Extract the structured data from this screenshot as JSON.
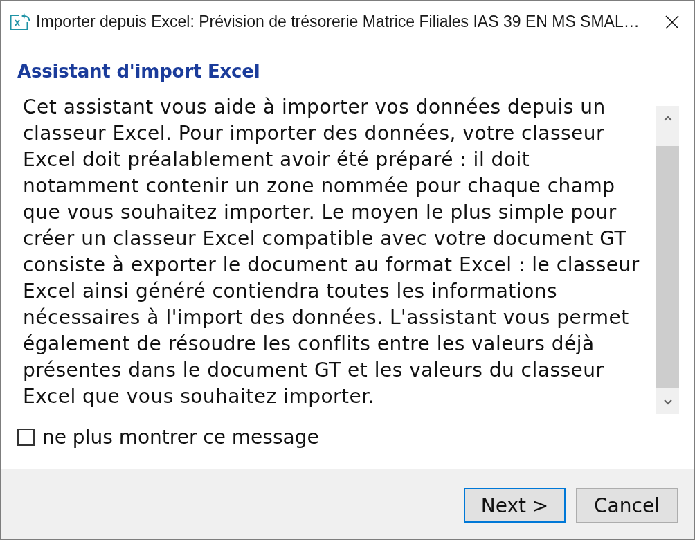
{
  "window": {
    "title": "Importer depuis Excel: Prévision de trésorerie Matrice Filiales IAS 39 EN MS SMAL…"
  },
  "heading": "Assistant d'import Excel",
  "message": "Cet assistant vous aide à importer vos données depuis un classeur Excel. Pour importer des données, votre classeur Excel doit préalablement avoir été préparé : il doit notamment contenir un zone nommée pour chaque champ que vous souhaitez importer. Le moyen le plus simple pour créer un classeur Excel compatible avec votre document GT consiste à exporter le document au format Excel : le classeur Excel ainsi généré contiendra toutes les informations nécessaires à l'import des données. L'assistant vous permet également de résoudre les conflits entre les valeurs déjà présentes dans le document GT et les valeurs du classeur Excel que vous souhaitez importer.",
  "dont_show_again": {
    "label": "ne plus montrer ce message",
    "checked": false
  },
  "buttons": [
    {
      "label": "Next >",
      "focused": true
    },
    {
      "label": "Cancel",
      "focused": false
    }
  ]
}
